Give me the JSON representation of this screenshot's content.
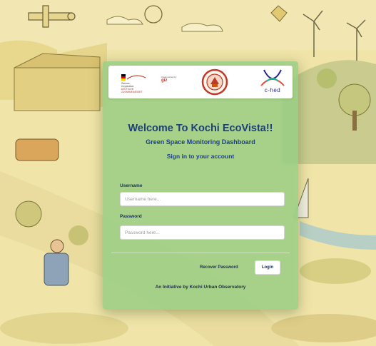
{
  "logos": {
    "giz": {
      "name": "german-cooperation-logo",
      "line1": "German",
      "line2": "Cooperation",
      "line3": "DEUTSCHE ZUSAMMENARBEIT"
    },
    "implemented": {
      "name": "implemented-by-giz-logo",
      "line1": "Implemented by",
      "brand": "giz"
    },
    "seal": {
      "name": "kochi-corporation-seal"
    },
    "ched": {
      "name": "c-hed-logo",
      "text": "c-hed"
    }
  },
  "login": {
    "title": "Welcome To Kochi EcoVista!!",
    "subtitle": "Green Space Monitoring Dashboard",
    "prompt": "Sign in to your account",
    "username_label": "Username",
    "username_placeholder": "Username here...",
    "password_label": "Password",
    "password_placeholder": "Password here...",
    "recover_label": "Recover Password",
    "login_label": "Login",
    "footer": "An Initiative by Kochi Urban Observatory"
  },
  "colors": {
    "background": "#efe3a6",
    "card": "#96cd82",
    "title": "#1f3f7a",
    "accent": "#1d3f86"
  }
}
